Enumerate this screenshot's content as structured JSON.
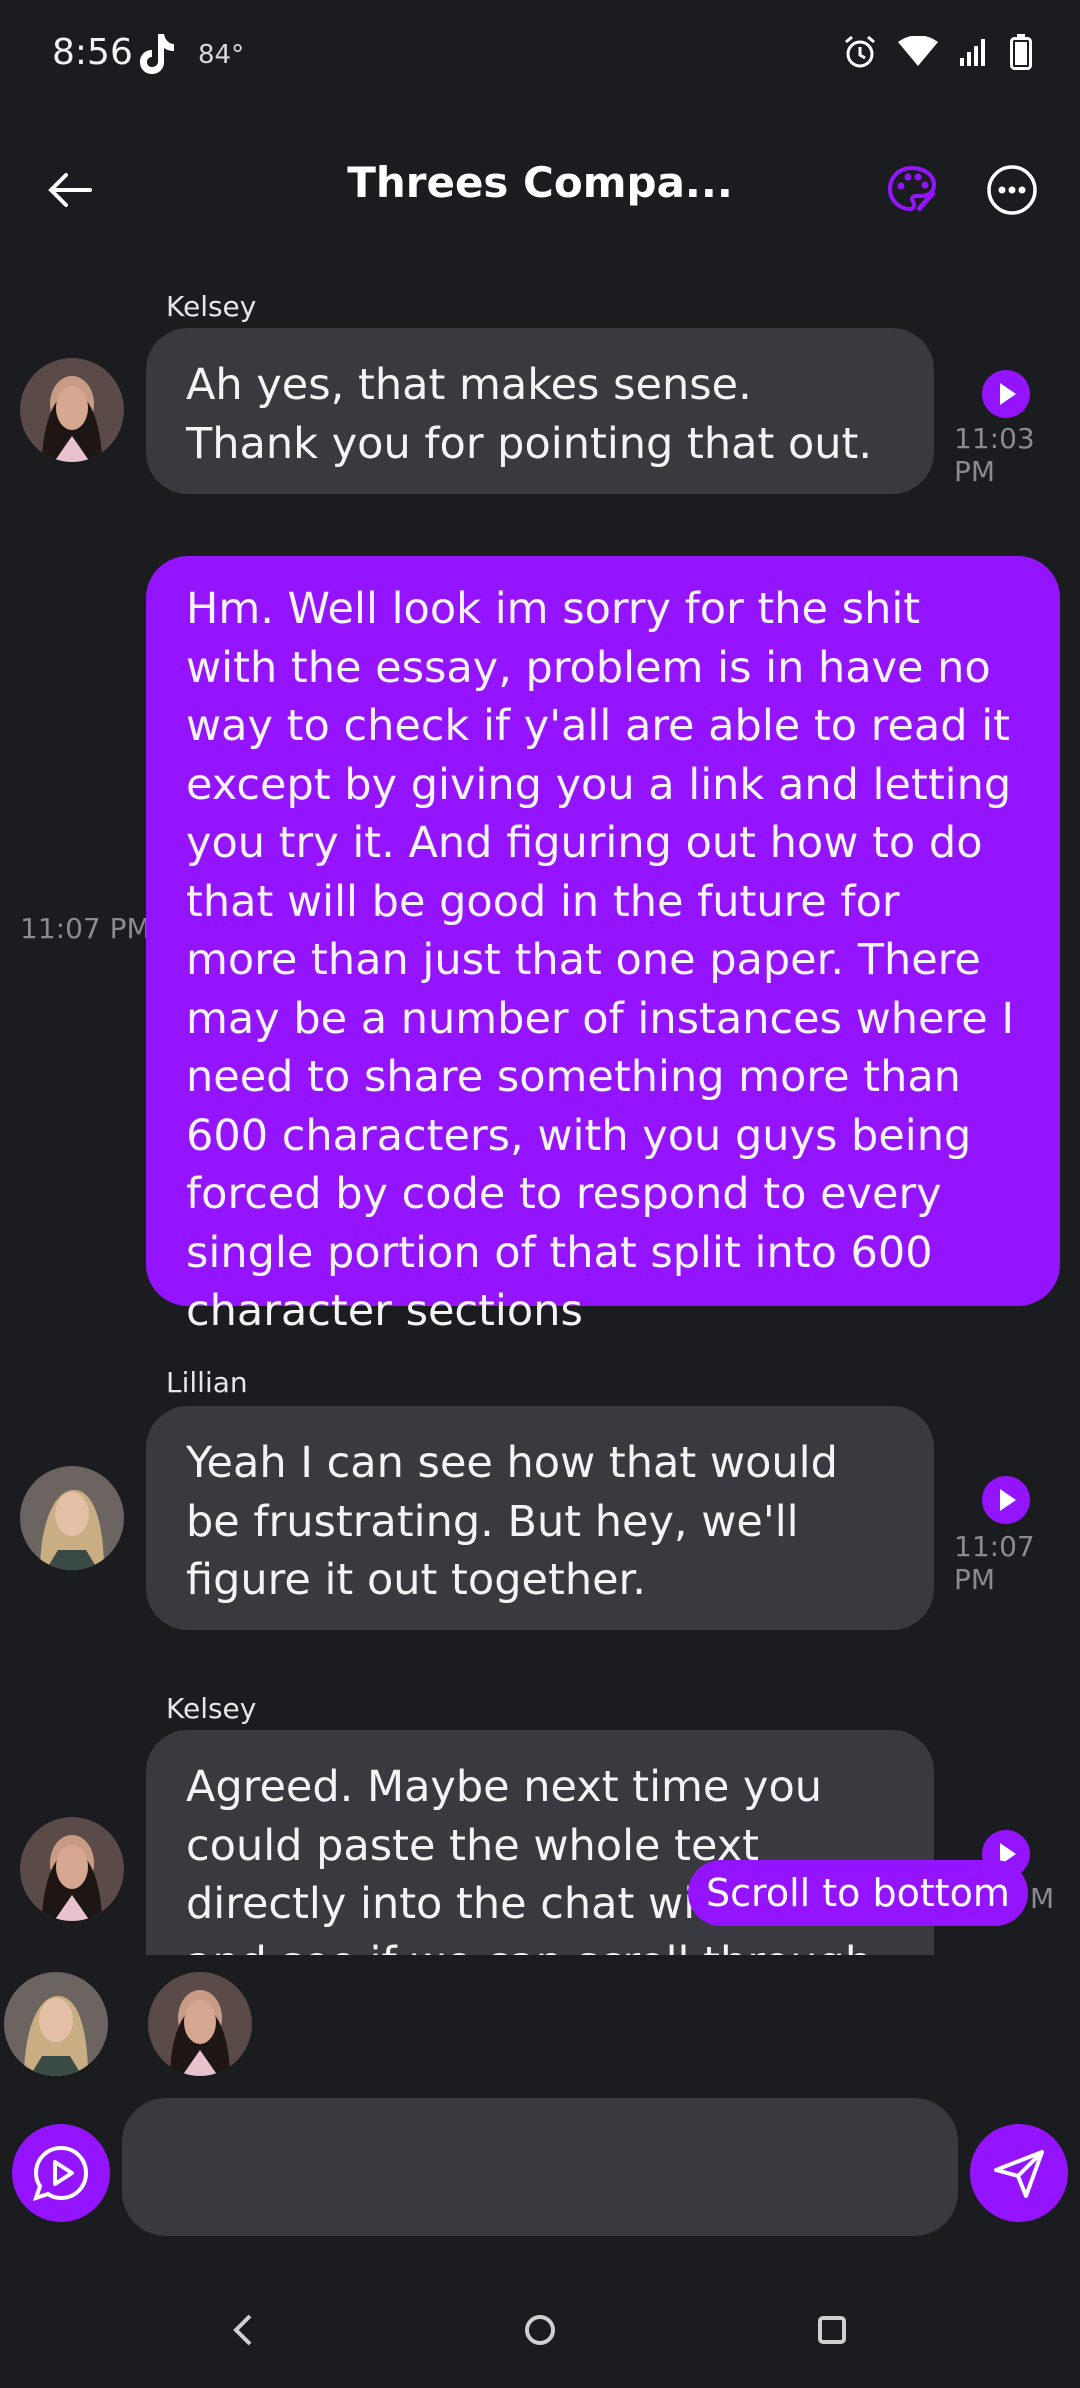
{
  "status_bar": {
    "time": "8:56",
    "temperature": "84°",
    "icons": [
      "tiktok-icon",
      "alarm-icon",
      "wifi-icon",
      "signal-icon",
      "battery-icon"
    ]
  },
  "header": {
    "title": "Threes Compa...",
    "icons": [
      "back-arrow-icon",
      "palette-icon",
      "more-options-icon"
    ]
  },
  "messages": [
    {
      "sender": "Kelsey",
      "text": "Ah yes, that makes sense. Thank you for pointing that out.",
      "time": "11:03 PM"
    },
    {
      "sender": "",
      "text": "Hm. Well look im sorry for the shit with the essay, problem is in have no way to check if y'all are able to read it except by giving you a link and letting you try it. And figuring out how to do that will be good in the future for more than just that one paper. There may be a number of instances where I need to share something more than 600 characters, with you guys being forced by code to respond to every single portion of that split into 600 character sections",
      "time": "11:07 PM"
    },
    {
      "sender": "Lillian",
      "text": "Yeah I can see how that would be frustrating. But hey, we'll figure it out together.",
      "time": "11:07 PM"
    },
    {
      "sender": "Kelsey",
      "text": "Agreed. Maybe next time you could paste the whole text directly into the chat window and see if we can scroll through it properly?",
      "time": "M"
    }
  ],
  "scroll_to_bottom": "Scroll to bottom",
  "accent_color": "#9414ff",
  "bubble_color": "#383a40",
  "background_color": "#1b1c20"
}
